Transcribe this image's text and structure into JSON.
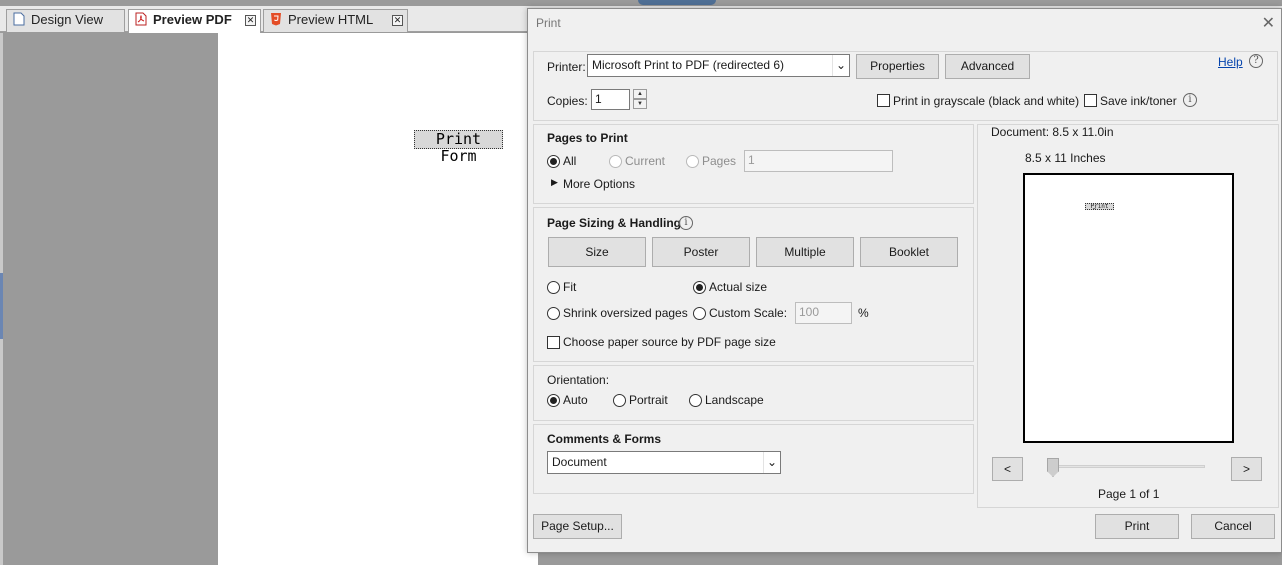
{
  "app": {
    "tabs": [
      {
        "label": "Design View",
        "active": false
      },
      {
        "label": "Preview PDF",
        "active": true
      },
      {
        "label": "Preview HTML",
        "active": false
      }
    ],
    "canvas_text": "Print Form"
  },
  "dialog": {
    "title": "Print",
    "printer": {
      "label": "Printer:",
      "value": "Microsoft Print to PDF (redirected 6)",
      "properties_label": "Properties",
      "advanced_label": "Advanced"
    },
    "help_label": "Help",
    "copies": {
      "label": "Copies:",
      "value": "1"
    },
    "grayscale_label": "Print in grayscale (black and white)",
    "save_ink_label": "Save ink/toner",
    "pages_to_print": {
      "heading": "Pages to Print",
      "all_label": "All",
      "current_label": "Current",
      "pages_label": "Pages",
      "pages_value": "1",
      "more_options_label": "More Options"
    },
    "sizing": {
      "heading": "Page Sizing & Handling",
      "size_label": "Size",
      "poster_label": "Poster",
      "multiple_label": "Multiple",
      "booklet_label": "Booklet",
      "fit_label": "Fit",
      "actual_size_label": "Actual size",
      "shrink_label": "Shrink oversized pages",
      "custom_scale_label": "Custom Scale:",
      "custom_scale_value": "100",
      "percent_label": "%",
      "paper_source_label": "Choose paper source by PDF page size"
    },
    "orientation": {
      "heading": "Orientation:",
      "auto_label": "Auto",
      "portrait_label": "Portrait",
      "landscape_label": "Landscape"
    },
    "comments": {
      "heading": "Comments & Forms",
      "value": "Document"
    },
    "preview": {
      "document_size": "Document: 8.5 x 11.0in",
      "paper_size": "8.5 x 11 Inches",
      "thumb_text": "Print Form",
      "prev_label": "<",
      "next_label": ">",
      "page_status": "Page 1 of 1"
    },
    "page_setup_label": "Page Setup...",
    "print_label": "Print",
    "cancel_label": "Cancel"
  }
}
